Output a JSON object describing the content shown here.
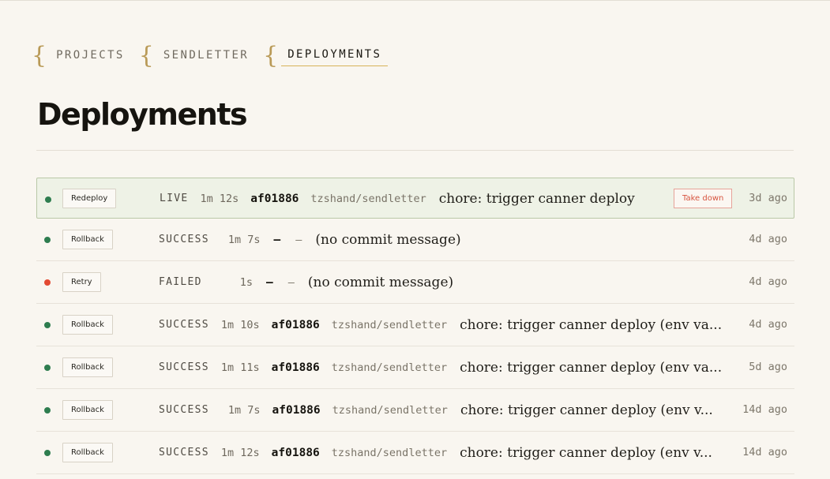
{
  "breadcrumb": {
    "items": [
      {
        "label": "PROJECTS"
      },
      {
        "label": "SENDLETTER"
      },
      {
        "label": "DEPLOYMENTS"
      }
    ]
  },
  "page": {
    "title": "Deployments"
  },
  "colors": {
    "background": "#f9f6f0",
    "live_row": "#eef2e6",
    "status_ok": "#2e7d4f",
    "status_failed": "#e34a33",
    "accent_underline": "#d7b35a",
    "danger": "#d7543f"
  },
  "deployments": [
    {
      "status_icon": "green-dot",
      "action": "Redeploy",
      "status": "LIVE",
      "duration": "1m 12s",
      "sha": "af01886",
      "repo": "tzshand/sendletter",
      "message": "chore: trigger canner deploy",
      "extra_action": "Take down",
      "age": "3d ago"
    },
    {
      "status_icon": "green-dot",
      "action": "Rollback",
      "status": "SUCCESS",
      "duration": "1m 7s",
      "sha": "—",
      "repo": "—",
      "message": "(no commit message)",
      "age": "4d ago"
    },
    {
      "status_icon": "red-dot",
      "action": "Retry",
      "status": "FAILED",
      "duration": "1s",
      "sha": "—",
      "repo": "—",
      "message": "(no commit message)",
      "age": "4d ago"
    },
    {
      "status_icon": "green-dot",
      "action": "Rollback",
      "status": "SUCCESS",
      "duration": "1m 10s",
      "sha": "af01886",
      "repo": "tzshand/sendletter",
      "message": "chore: trigger canner deploy (env va...",
      "age": "4d ago"
    },
    {
      "status_icon": "green-dot",
      "action": "Rollback",
      "status": "SUCCESS",
      "duration": "1m 11s",
      "sha": "af01886",
      "repo": "tzshand/sendletter",
      "message": "chore: trigger canner deploy (env va...",
      "age": "5d ago"
    },
    {
      "status_icon": "green-dot",
      "action": "Rollback",
      "status": "SUCCESS",
      "duration": "1m 7s",
      "sha": "af01886",
      "repo": "tzshand/sendletter",
      "message": "chore: trigger canner deploy (env v...",
      "age": "14d ago"
    },
    {
      "status_icon": "green-dot",
      "action": "Rollback",
      "status": "SUCCESS",
      "duration": "1m 12s",
      "sha": "af01886",
      "repo": "tzshand/sendletter",
      "message": "chore: trigger canner deploy (env v...",
      "age": "14d ago"
    }
  ]
}
